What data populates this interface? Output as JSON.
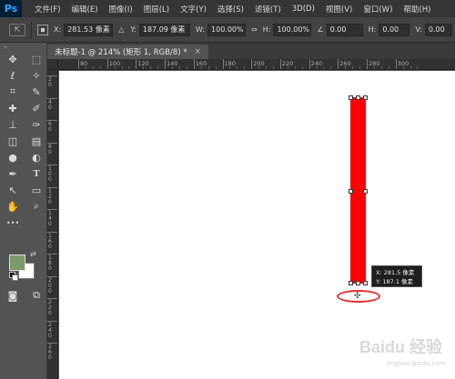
{
  "app": {
    "logo": "Ps"
  },
  "menu": [
    "文件(F)",
    "编辑(E)",
    "图像(I)",
    "图层(L)",
    "文字(Y)",
    "选择(S)",
    "滤镜(T)",
    "3D(D)",
    "视图(V)",
    "窗口(W)",
    "帮助(H)"
  ],
  "options": {
    "x_label": "X:",
    "x_value": "281.53 像素",
    "delta_icon": "△",
    "y_label": "Y:",
    "y_value": "187.09 像素",
    "w_label": "W:",
    "w_value": "100.00%",
    "link_icon": "⇔",
    "h_label": "H:",
    "h_value": "100.00%",
    "angle_icon": "∠",
    "angle_value": "0.00",
    "hskew_label": "H:",
    "hskew_value": "0.00",
    "vskew_label": "V:",
    "vskew_value": "0.00"
  },
  "document": {
    "tab_title": "未标题-1 @ 214% (矩形 1, RGB/8) *",
    "close": "×"
  },
  "ruler_top": [
    "80",
    "100",
    "120",
    "140",
    "160",
    "180",
    "200",
    "220",
    "240",
    "260",
    "280",
    "300"
  ],
  "ruler_left": [
    "20",
    "40",
    "60",
    "80",
    "100",
    "120",
    "140",
    "160",
    "180",
    "200",
    "220",
    "240",
    "260"
  ],
  "tools": {
    "move": "✥",
    "marquee": "⬚",
    "lasso": "ℓ",
    "magic_wand": "✧",
    "crop": "⌗",
    "eyedropper": "✎",
    "healing": "✚",
    "brush": "✐",
    "stamp": "⊥",
    "history_brush": "✑",
    "eraser": "◫",
    "gradient": "▤",
    "blur": "●",
    "dodge": "◐",
    "pen": "✒",
    "type": "T",
    "path_select": "↖",
    "shape": "▭",
    "hand": "✋",
    "zoom": "⌕",
    "more": "•••"
  },
  "colors": {
    "foreground": "#7a9a6c",
    "background": "#ffffff",
    "shape_fill": "#ff0000",
    "highlight_circle": "#e53030"
  },
  "tooltip": {
    "x": "X: 281.5 像素",
    "y": "Y: 187.1 像素"
  },
  "watermark": {
    "text": "Baidu 经验",
    "url": "jingyan.baidu.com"
  }
}
